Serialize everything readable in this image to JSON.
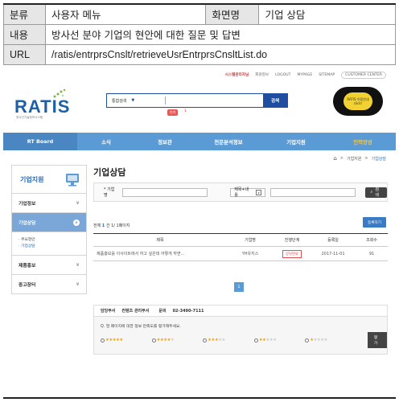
{
  "doc": {
    "row1": {
      "k1": "분류",
      "v1": "사용자 메뉴",
      "k2": "화면명",
      "v2": "기업 상담"
    },
    "row2": {
      "k": "내용",
      "v": "방사선 분야 기업의 현안에 대한 질문 및 답변"
    },
    "row3": {
      "k": "URL",
      "v": "/ratis/entrprsCnslt/retrieveUsrEntrprsCnsltList.do"
    }
  },
  "topbar": [
    "시스템관리자님",
    "회원정보",
    "LOGOUT",
    "MYPAGE",
    "SITEMAP",
    "CUSTOMER CENTER"
  ],
  "logo": {
    "word": "RATIS",
    "sub": "방사선기술정보시스템"
  },
  "search": {
    "scope": "통합검색",
    "button": "검색",
    "hot_label": "인기",
    "hot_count": "1"
  },
  "promo": {
    "text": "RATIS 이용안내 click!"
  },
  "gnb": {
    "home": "RT Board",
    "items": [
      "소식",
      "정보관",
      "전문분석정보",
      "기업지원",
      "인력양성"
    ]
  },
  "sidebar": {
    "title": "기업지원",
    "menus": [
      "기업정보",
      "기업상담",
      "제품홍보",
      "중고장터"
    ],
    "sub": [
      "주요현안",
      "기업상담"
    ]
  },
  "breadcrumb": [
    "기업지원",
    "기업상담"
  ],
  "page_title": "기업상담",
  "filter": {
    "company_label": "* 기업명",
    "select": "제목+내용",
    "button": "검색"
  },
  "count": {
    "prefix": "전체",
    "total": "1",
    "suffix": "건 1/ 1페이지"
  },
  "register": "등록하기",
  "table": {
    "headers": [
      "제목",
      "기업명",
      "진행단계",
      "등록일",
      "조회수"
    ],
    "rows": [
      {
        "title": "제품홍보를 이사이트에서 하고 싶은데 어떻게 하면...",
        "company": "YH유지스",
        "status": "상담완료",
        "date": "2017-11-01",
        "views": "91"
      }
    ]
  },
  "pager": "1",
  "survey": {
    "dept_label": "담당부서",
    "dept": "컨텐츠 관리부서",
    "tel_label": "문의",
    "tel": "02-3490-7111",
    "question": "Q. 현 페이지에 대한 정보 만족도를 평가해주세요.",
    "ratings": [
      5,
      4,
      3,
      2,
      1
    ],
    "button": "평가"
  },
  "colors": {
    "gnb": "#5b9bd5",
    "brand": "#1d60a8",
    "accent": "#e05050"
  }
}
